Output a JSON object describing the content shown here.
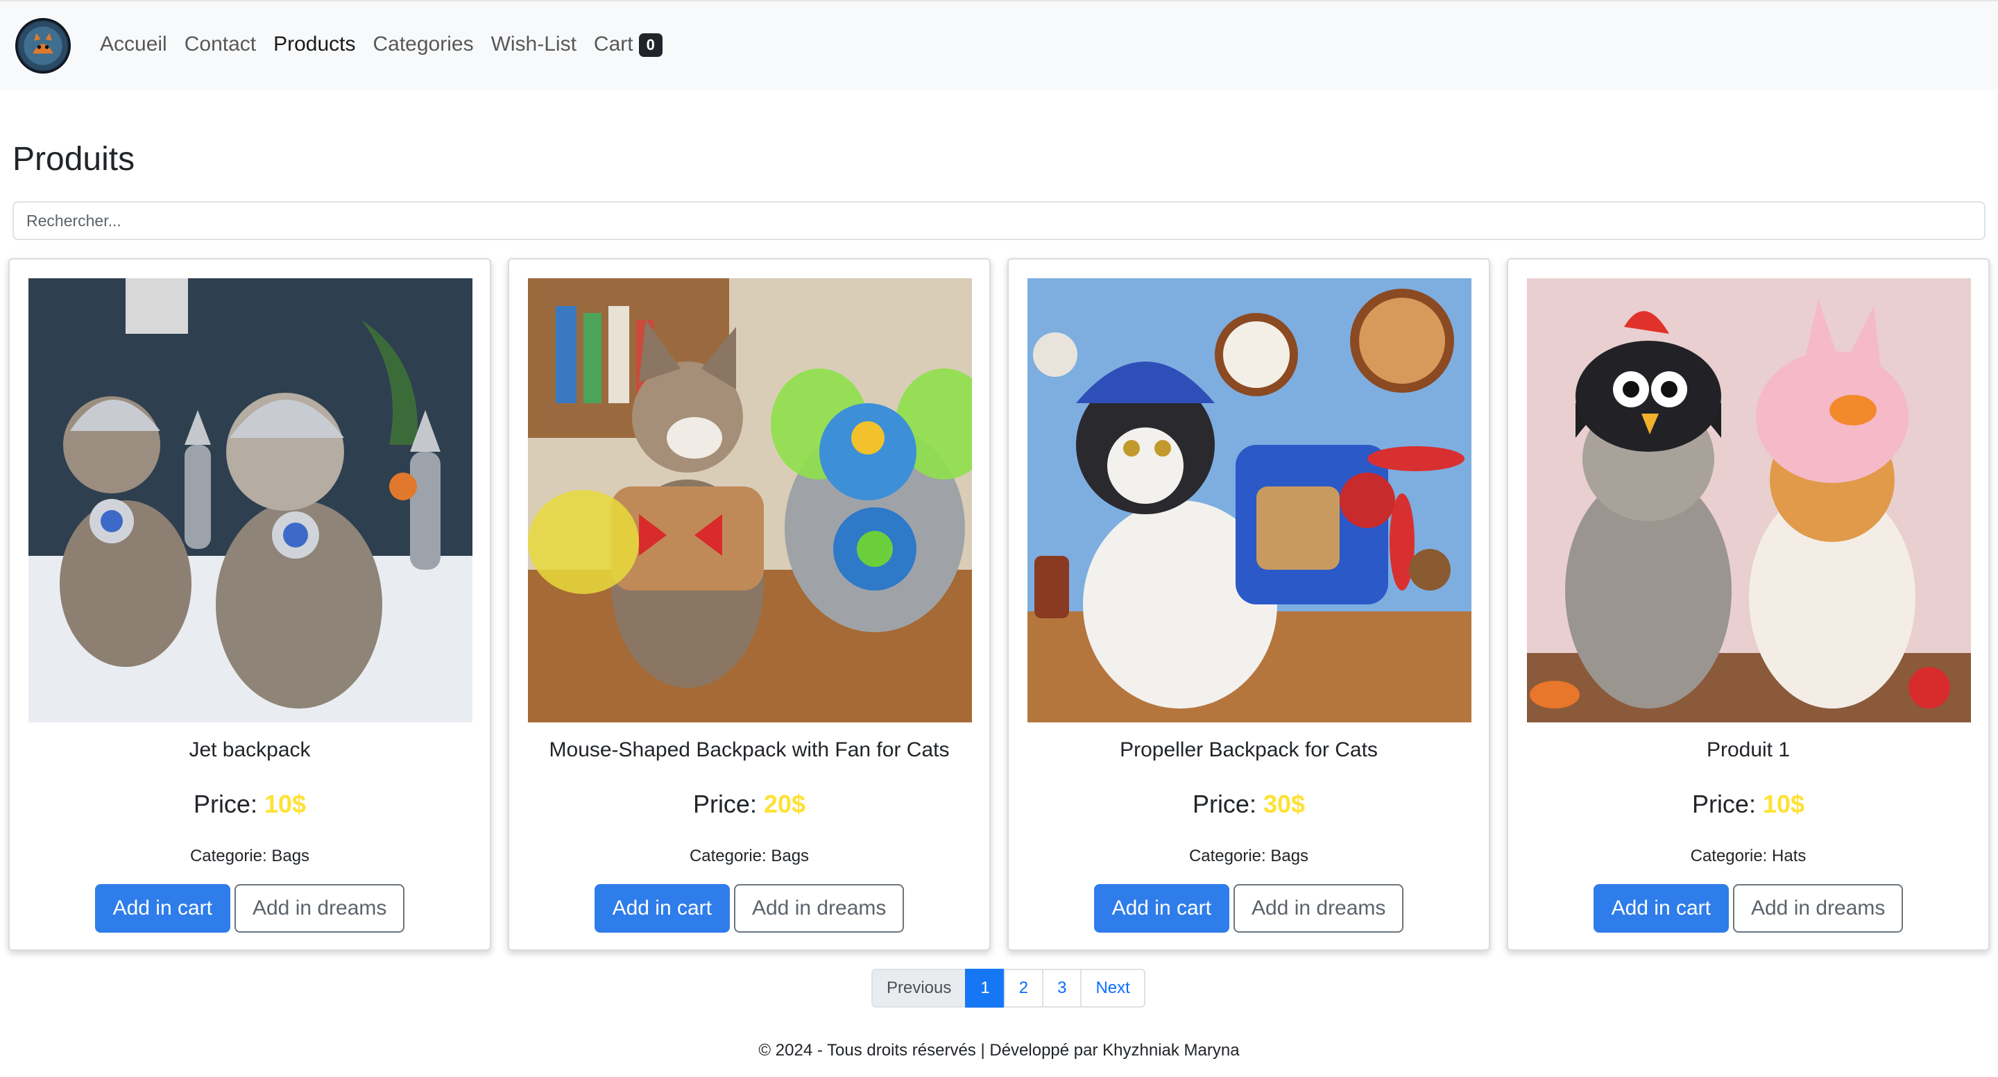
{
  "navbar": {
    "logo_alt": "logo",
    "links": [
      "Accueil",
      "Contact",
      "Products",
      "Categories",
      "Wish-List",
      "Cart"
    ],
    "active": "Products",
    "cart_count": "0"
  },
  "page": {
    "title": "Produits",
    "search_placeholder": "Rechercher..."
  },
  "products": [
    {
      "name": "Jet backpack",
      "price_label": "Price:",
      "price": "10$",
      "category_label": "Categorie:",
      "category": "Bags",
      "add_cart": "Add in cart",
      "add_dreams": "Add in dreams"
    },
    {
      "name": "Mouse-Shaped Backpack with Fan for Cats",
      "price_label": "Price:",
      "price": "20$",
      "category_label": "Categorie:",
      "category": "Bags",
      "add_cart": "Add in cart",
      "add_dreams": "Add in dreams"
    },
    {
      "name": "Propeller Backpack for Cats",
      "price_label": "Price:",
      "price": "30$",
      "category_label": "Categorie:",
      "category": "Bags",
      "add_cart": "Add in cart",
      "add_dreams": "Add in dreams"
    },
    {
      "name": "Produit 1",
      "price_label": "Price:",
      "price": "10$",
      "category_label": "Categorie:",
      "category": "Hats",
      "add_cart": "Add in cart",
      "add_dreams": "Add in dreams"
    }
  ],
  "pagination": {
    "previous": "Previous",
    "pages": [
      "1",
      "2",
      "3"
    ],
    "current": "1",
    "next": "Next"
  },
  "footer": {
    "text": "© 2024 - Tous droits réservés | Développé par Khyzhniak Maryna"
  },
  "colors": {
    "price": "#ffe135",
    "primary": "#2f7dea",
    "navbar_bg": "#f8f9fa"
  }
}
